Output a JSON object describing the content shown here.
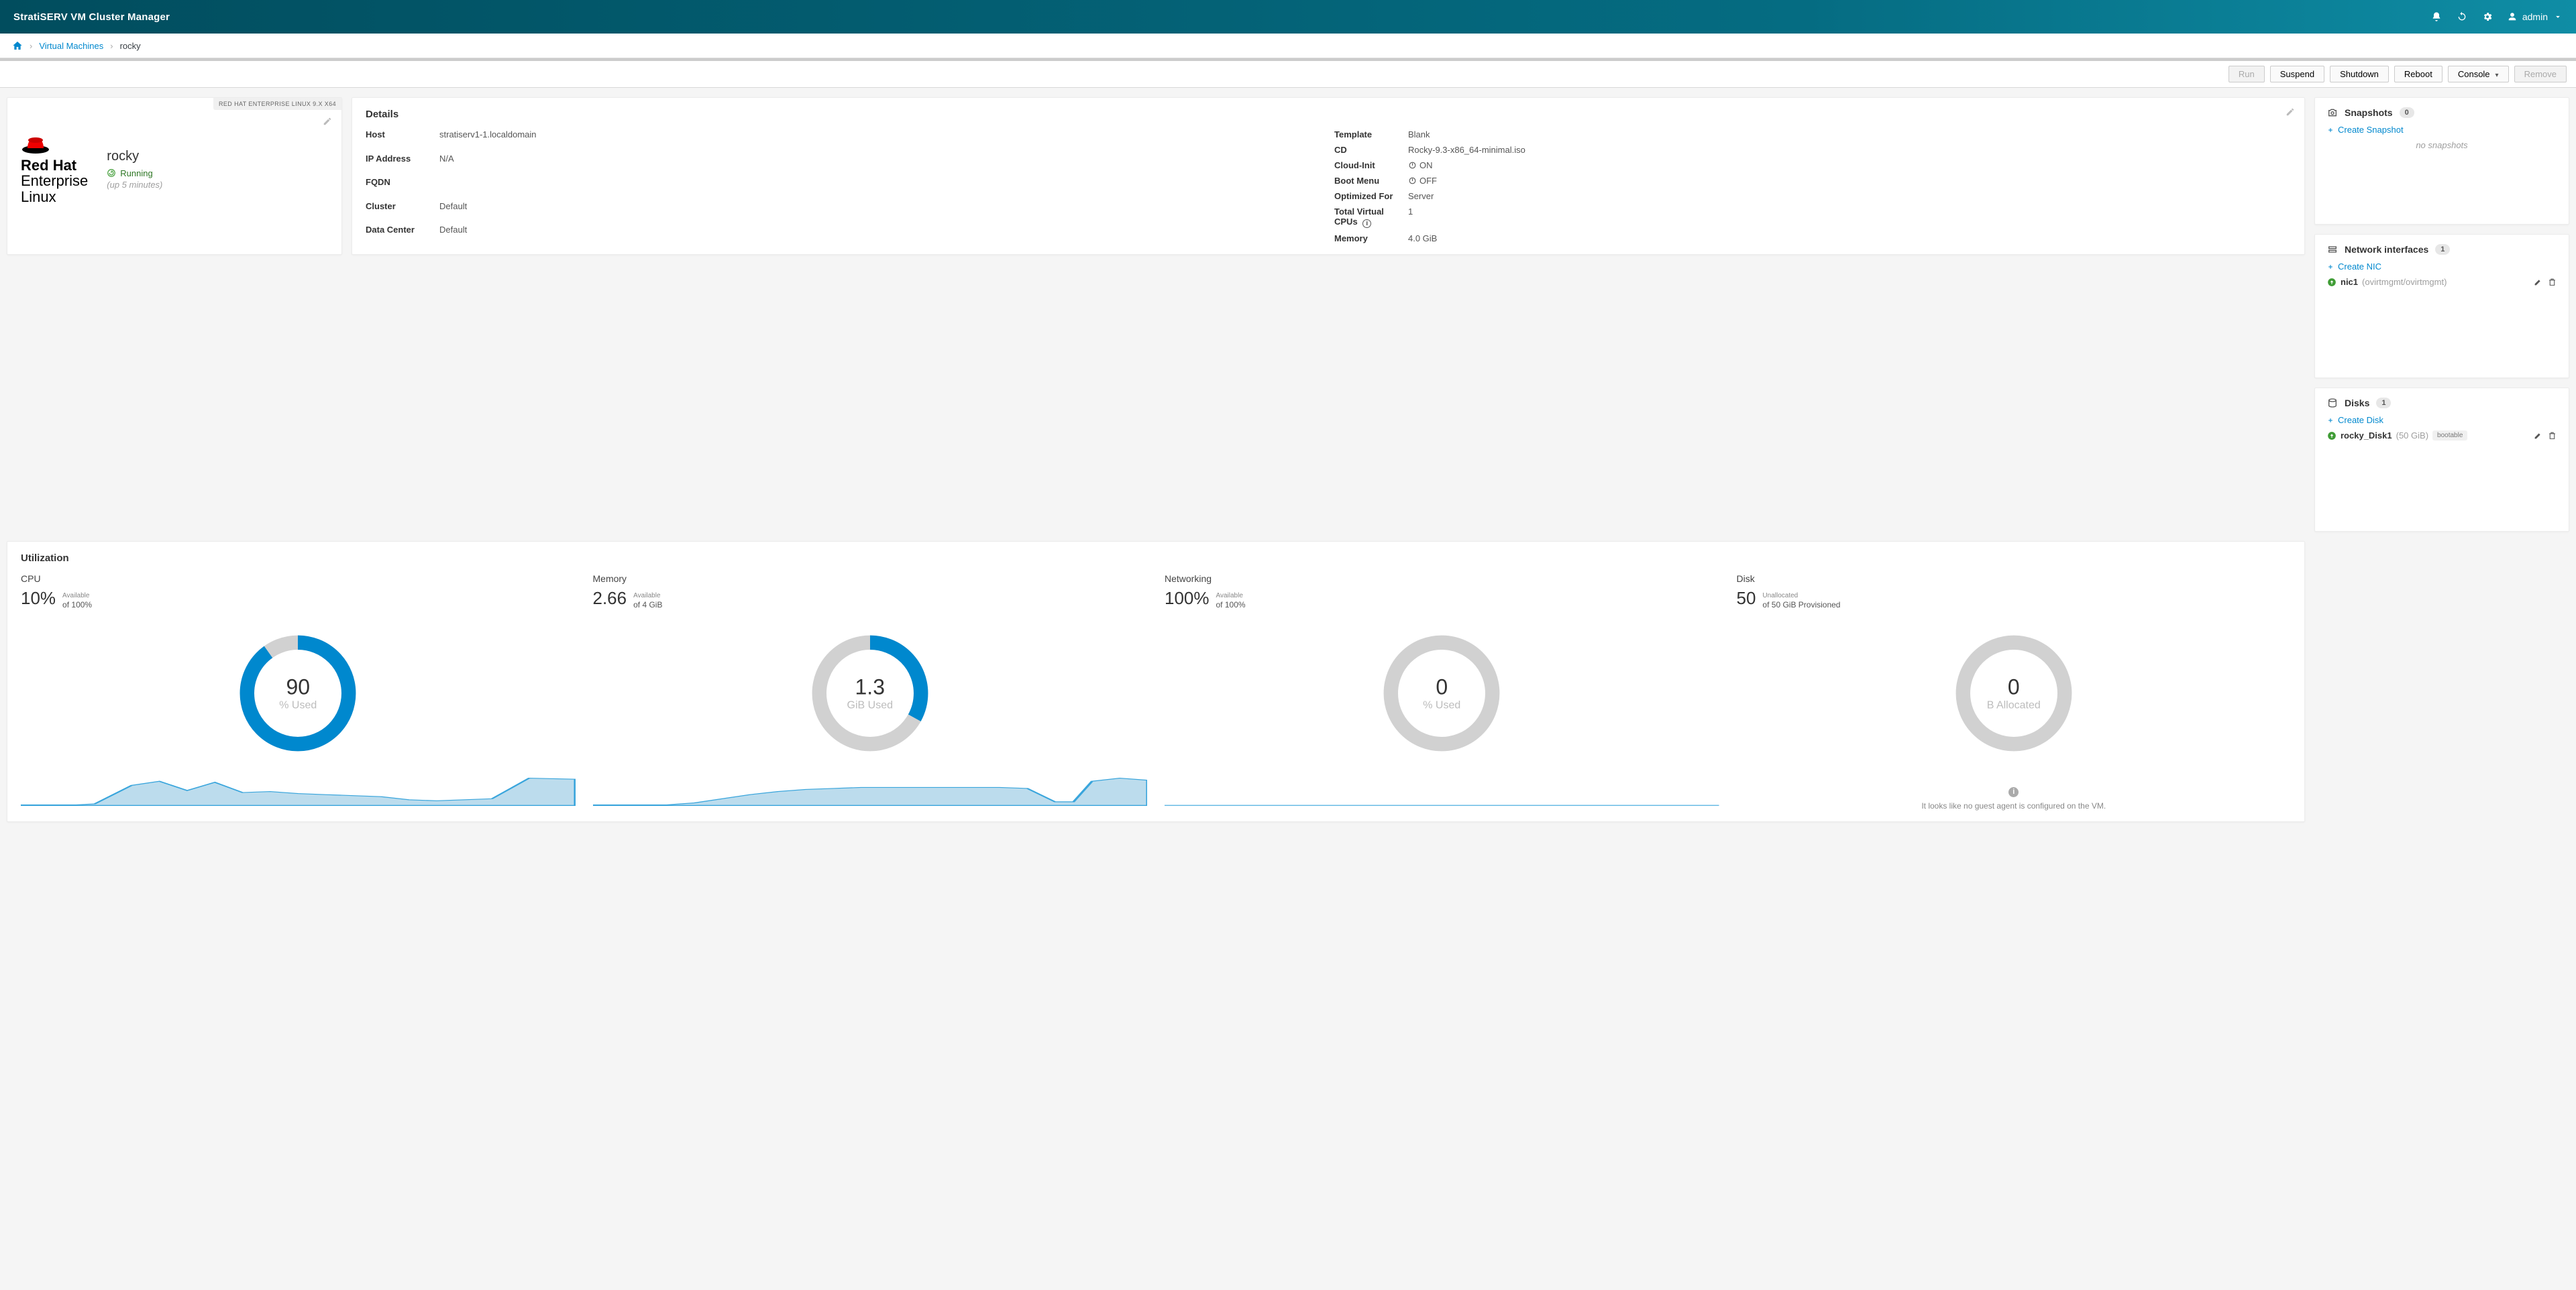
{
  "brand": "StratiSERV VM Cluster Manager",
  "user": {
    "name": "admin"
  },
  "crumbs": {
    "link": "Virtual Machines",
    "current": "rocky"
  },
  "toolbar": {
    "run": "Run",
    "suspend": "Suspend",
    "shutdown": "Shutdown",
    "reboot": "Reboot",
    "console": "Console",
    "remove": "Remove"
  },
  "vm": {
    "name": "rocky",
    "os_badge": "RED HAT ENTERPRISE LINUX 9.X X64",
    "status_label": "Running",
    "uptime": "(up 5 minutes)",
    "vendor": {
      "hat_top": "Red",
      "hat_brand": "Hat",
      "line2": "Enterprise",
      "line3": "Linux"
    }
  },
  "details": {
    "title": "Details",
    "left": {
      "Host": "stratiserv1-1.localdomain",
      "IP Address": "N/A",
      "FQDN": "",
      "Cluster": "Default",
      "Data Center": "Default"
    },
    "right": {
      "Template": "Blank",
      "CD": "Rocky-9.3-x86_64-minimal.iso",
      "Cloud-Init": "ON",
      "Boot Menu": "OFF",
      "Optimized For": "Server",
      "Total Virtual CPUs": "1",
      "Memory": "4.0 GiB"
    }
  },
  "snapshots": {
    "title": "Snapshots",
    "count": "0",
    "create": "Create Snapshot",
    "empty": "no snapshots"
  },
  "nics": {
    "title": "Network interfaces",
    "count": "1",
    "create": "Create NIC",
    "item": {
      "name": "nic1",
      "desc": "(ovirtmgmt/ovirtmgmt)"
    }
  },
  "disks": {
    "title": "Disks",
    "count": "1",
    "create": "Create Disk",
    "item": {
      "name": "rocky_Disk1",
      "size": "(50 GiB)",
      "tag": "bootable"
    }
  },
  "util": {
    "title": "Utilization",
    "cpu": {
      "label": "CPU",
      "value": "10%",
      "cap_top": "Available",
      "cap_bot": "of 100%",
      "donut_num": "90",
      "donut_unit": "% Used",
      "pct_used": 90
    },
    "mem": {
      "label": "Memory",
      "value": "2.66",
      "cap_top": "Available",
      "cap_bot": "of 4 GiB",
      "donut_num": "1.3",
      "donut_unit": "GiB Used",
      "pct_used": 33
    },
    "net": {
      "label": "Networking",
      "value": "100%",
      "cap_top": "Available",
      "cap_bot": "of 100%",
      "donut_num": "0",
      "donut_unit": "% Used",
      "pct_used": 0
    },
    "disk": {
      "label": "Disk",
      "value": "50",
      "cap_top": "Unallocated",
      "cap_bot": "of 50 GiB Provisioned",
      "donut_num": "0",
      "donut_unit": "B Allocated",
      "pct_used": 0
    },
    "no_agent": "It looks like no guest agent is configured on the VM."
  },
  "chart_data": [
    {
      "type": "donut",
      "name": "cpu",
      "value": 90,
      "max": 100,
      "unit": "% Used",
      "ring_used_color": "#0088ce",
      "ring_free_color": "#d1d1d1"
    },
    {
      "type": "donut",
      "name": "memory",
      "value_display": 1.3,
      "value_pct": 33,
      "max": 4,
      "unit": "GiB Used",
      "ring_used_color": "#0088ce",
      "ring_free_color": "#d1d1d1"
    },
    {
      "type": "donut",
      "name": "networking",
      "value": 0,
      "max": 100,
      "unit": "% Used",
      "ring_used_color": "#0088ce",
      "ring_free_color": "#d1d1d1"
    },
    {
      "type": "donut",
      "name": "disk",
      "value": 0,
      "max": 50,
      "unit": "B Allocated",
      "ring_used_color": "#0088ce",
      "ring_free_color": "#d1d1d1"
    },
    {
      "type": "area",
      "name": "cpu_spark",
      "x": [
        0,
        1,
        2,
        3,
        4,
        5,
        6,
        7,
        8,
        9,
        10,
        11,
        12,
        13,
        14,
        15,
        16,
        17,
        18,
        19
      ],
      "y": [
        0,
        0,
        2,
        30,
        40,
        28,
        42,
        24,
        26,
        22,
        20,
        18,
        16,
        14,
        10,
        8,
        10,
        12,
        50,
        48
      ],
      "ylim": [
        0,
        60
      ],
      "fill": "#bcdced",
      "stroke": "#39a5dc"
    },
    {
      "type": "area",
      "name": "mem_spark",
      "x": [
        0,
        1,
        2,
        3,
        4,
        5,
        6,
        7,
        8,
        9,
        10,
        11,
        12,
        13,
        14,
        15,
        16,
        17,
        18,
        19
      ],
      "y": [
        0,
        0,
        0,
        4,
        10,
        16,
        22,
        26,
        28,
        30,
        30,
        30,
        30,
        30,
        30,
        30,
        28,
        6,
        42,
        40
      ],
      "ylim": [
        0,
        50
      ],
      "fill": "#bcdced",
      "stroke": "#39a5dc"
    },
    {
      "type": "area",
      "name": "net_spark",
      "x": [
        0,
        1
      ],
      "y": [
        0,
        0
      ],
      "ylim": [
        0,
        10
      ],
      "fill": "#bcdced",
      "stroke": "#39a5dc"
    }
  ]
}
